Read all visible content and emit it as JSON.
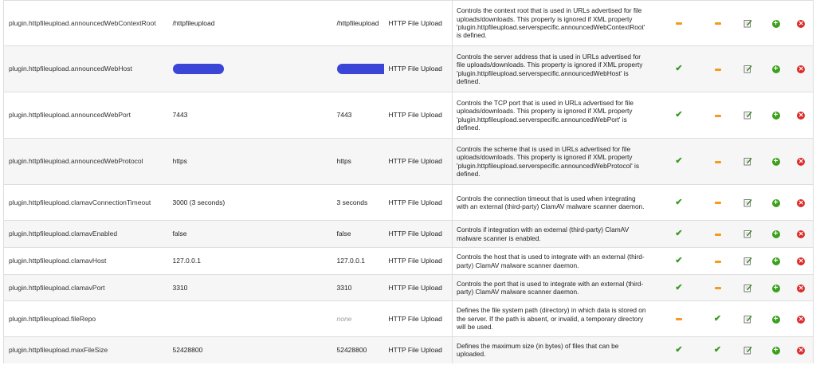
{
  "icons": {
    "check": "✔",
    "plus": "+",
    "delete": "✕"
  },
  "rows": [
    {
      "name": "plugin.httpfileupload.announcedWebContextRoot",
      "value": "/httpfileupload",
      "default": "/httpfileupload",
      "plugin": "HTTP File Upload",
      "desc": "Controls the context root that is used in URLs advertised for file uploads/downloads. This property is ignored if XML property 'plugin.httpfileupload.serverspecific.announcedWebContextRoot' is defined.",
      "a": "dash",
      "b": "dash"
    },
    {
      "name": "plugin.httpfileupload.announcedWebHost",
      "value": "",
      "default": "",
      "redacted": true,
      "plugin": "HTTP File Upload",
      "desc": "Controls the server address that is used in URLs advertised for file uploads/downloads. This property is ignored if XML property 'plugin.httpfileupload.serverspecific.announcedWebHost' is defined.",
      "a": "check",
      "b": "dash"
    },
    {
      "name": "plugin.httpfileupload.announcedWebPort",
      "value": "7443",
      "default": "7443",
      "plugin": "HTTP File Upload",
      "desc": "Controls the TCP port that is used in URLs advertised for file uploads/downloads. This property is ignored if XML property 'plugin.httpfileupload.serverspecific.announcedWebPort' is defined.",
      "a": "check",
      "b": "dash"
    },
    {
      "name": "plugin.httpfileupload.announcedWebProtocol",
      "value": "https",
      "default": "https",
      "plugin": "HTTP File Upload",
      "desc": "Controls the scheme that is used in URLs advertised for file uploads/downloads. This property is ignored if XML property 'plugin.httpfileupload.serverspecific.announcedWebProtocol' is defined.",
      "a": "check",
      "b": "dash"
    },
    {
      "name": "plugin.httpfileupload.clamavConnectionTimeout",
      "value": "3000 (3 seconds)",
      "default": "3 seconds",
      "plugin": "HTTP File Upload",
      "desc": "Controls the connection timeout that is used when integrating with an external (third-party) ClamAV malware scanner daemon.",
      "a": "check",
      "b": "dash"
    },
    {
      "name": "plugin.httpfileupload.clamavEnabled",
      "value": "false",
      "default": "false",
      "plugin": "HTTP File Upload",
      "desc": "Controls if integration with an external (third-party) ClamAV malware scanner is enabled.",
      "a": "check",
      "b": "dash"
    },
    {
      "name": "plugin.httpfileupload.clamavHost",
      "value": "127.0.0.1",
      "default": "127.0.0.1",
      "plugin": "HTTP File Upload",
      "desc": "Controls the host that is used to integrate with an external (third-party) ClamAV malware scanner daemon.",
      "a": "check",
      "b": "dash"
    },
    {
      "name": "plugin.httpfileupload.clamavPort",
      "value": "3310",
      "default": "3310",
      "plugin": "HTTP File Upload",
      "desc": "Controls the port that is used to integrate with an external (third-party) ClamAV malware scanner daemon.",
      "a": "check",
      "b": "dash"
    },
    {
      "name": "plugin.httpfileupload.fileRepo",
      "value": "",
      "default": "none",
      "defaultNone": true,
      "plugin": "HTTP File Upload",
      "desc": "Defines the file system path (directory) in which data is stored on the server. If the path is absent, or invalid, a temporary directory will be used.",
      "a": "dash",
      "b": "check"
    },
    {
      "name": "plugin.httpfileupload.maxFileSize",
      "value": "52428800",
      "default": "52428800",
      "plugin": "HTTP File Upload",
      "desc": "Defines the maximum size (in bytes) of files that can be uploaded.",
      "a": "check",
      "b": "check"
    }
  ]
}
